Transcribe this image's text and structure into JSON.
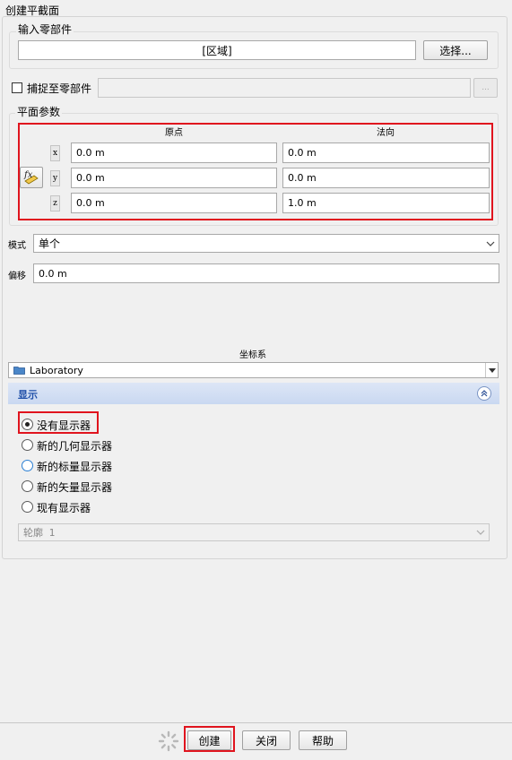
{
  "dialog": {
    "title": "创建平截面",
    "input_parts": {
      "group_label": "输入零部件",
      "region_value": "[区域]",
      "select_button": "选择..."
    },
    "snap": {
      "label": "捕捉至零部件",
      "checked": false,
      "value": "",
      "browse_button": "..."
    },
    "plane_params": {
      "group_label": "平面参数",
      "origin_header": "原点",
      "normal_header": "法向",
      "axes": [
        "x",
        "y",
        "z"
      ],
      "origin": [
        "0.0 m",
        "0.0 m",
        "0.0 m"
      ],
      "normal": [
        "0.0 m",
        "0.0 m",
        "1.0 m"
      ],
      "expression_icon": "fx-icon"
    },
    "mode": {
      "label": "模式",
      "value": "单个"
    },
    "offset": {
      "label": "偏移",
      "value": "0.0 m"
    },
    "coordinate_system": {
      "label": "坐标系",
      "value": "Laboratory",
      "icon": "folder-icon"
    },
    "display": {
      "header": "显示",
      "options": [
        {
          "label": "没有显示器",
          "selected": true
        },
        {
          "label": "新的几何显示器",
          "selected": false
        },
        {
          "label": "新的标量显示器",
          "selected": false
        },
        {
          "label": "新的矢量显示器",
          "selected": false
        },
        {
          "label": "现有显示器",
          "selected": false
        }
      ],
      "existing_select_value": "轮廓 1"
    },
    "footer": {
      "create_button": "创建",
      "close_button": "关闭",
      "help_button": "帮助"
    }
  }
}
